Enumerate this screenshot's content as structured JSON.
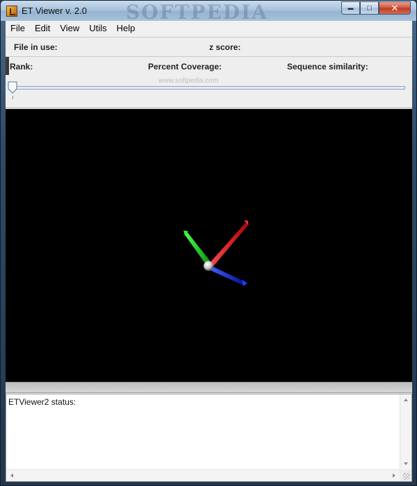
{
  "window": {
    "title": "ET Viewer v. 2.0",
    "watermark": "SOFTPEDIA",
    "controls": {
      "minimize": "▬",
      "maximize": "□",
      "close": "✕"
    }
  },
  "menu": {
    "items": [
      {
        "label": "File"
      },
      {
        "label": "Edit"
      },
      {
        "label": "View"
      },
      {
        "label": "Utils"
      },
      {
        "label": "Help"
      }
    ]
  },
  "info": {
    "file_in_use_label": "File in use:",
    "z_score_label": "z score:",
    "rank_label": "Rank:",
    "percent_coverage_label": "Percent Coverage:",
    "sequence_similarity_label": "Sequence similarity:"
  },
  "slider": {
    "value_fraction": 0,
    "small_watermark": "www.softpedia.com"
  },
  "viewport": {
    "background": "#000000",
    "axes": {
      "x_color": "#e01010",
      "y_color": "#10d010",
      "z_color": "#1020e0",
      "origin_color": "#e8e8e8"
    }
  },
  "status": {
    "text": "ETViewer2 status:"
  },
  "icons": {
    "app": "app-icon",
    "minimize": "minimize-icon",
    "maximize": "maximize-icon",
    "close": "close-icon"
  }
}
